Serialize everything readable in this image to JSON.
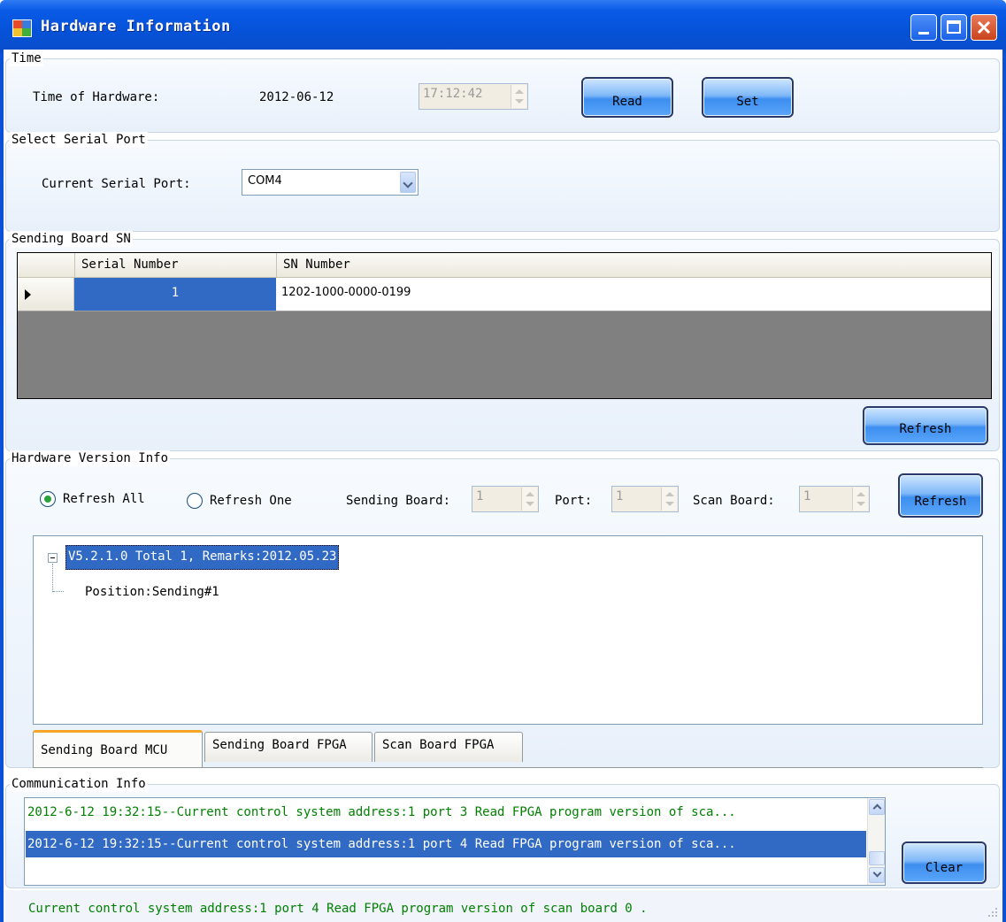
{
  "window": {
    "title": "Hardware Information"
  },
  "time_group": {
    "title": "Time",
    "label": "Time of Hardware:",
    "date": "2012-06-12",
    "time_value": "17:12:42",
    "read_label": "Read",
    "set_label": "Set"
  },
  "serial_group": {
    "title": "Select Serial Port",
    "label": "Current Serial Port:",
    "selected": "COM4"
  },
  "sn_group": {
    "title": "Sending Board SN",
    "columns": [
      "Serial Number",
      "SN Number"
    ],
    "rows": [
      {
        "serial": "1",
        "sn": "1202-1000-0000-0199"
      }
    ],
    "refresh_label": "Refresh"
  },
  "version_group": {
    "title": "Hardware Version Info",
    "refresh_all_label": "Refresh All",
    "refresh_one_label": "Refresh One",
    "selected_mode": "Refresh All",
    "sending_board_label": "Sending Board:",
    "sending_board_value": "1",
    "port_label": "Port:",
    "port_value": "1",
    "scan_board_label": "Scan Board:",
    "scan_board_value": "1",
    "refresh_label": "Refresh",
    "tree": {
      "root": "V5.2.1.0 Total 1, Remarks:2012.05.23",
      "child": "Position:Sending#1"
    },
    "tabs": [
      "Sending Board MCU",
      "Sending Board FPGA",
      "Scan Board FPGA"
    ],
    "active_tab": "Sending Board MCU"
  },
  "comm_group": {
    "title": "Communication Info",
    "items": [
      "2012-6-12 19:32:15--Current control system address:1 port 3 Read FPGA program version of sca...",
      "2012-6-12 19:32:15--Current control system address:1 port 4 Read FPGA program version of sca..."
    ],
    "selected_index": 1,
    "clear_label": "Clear"
  },
  "status_bar": {
    "text": "Current control system address:1 port 4 Read FPGA program version of scan board 0 ."
  },
  "colors": {
    "titlebar": "#0552d8",
    "selection": "#316ac5",
    "log_text": "#008000",
    "tab_accent": "#f5a623"
  }
}
